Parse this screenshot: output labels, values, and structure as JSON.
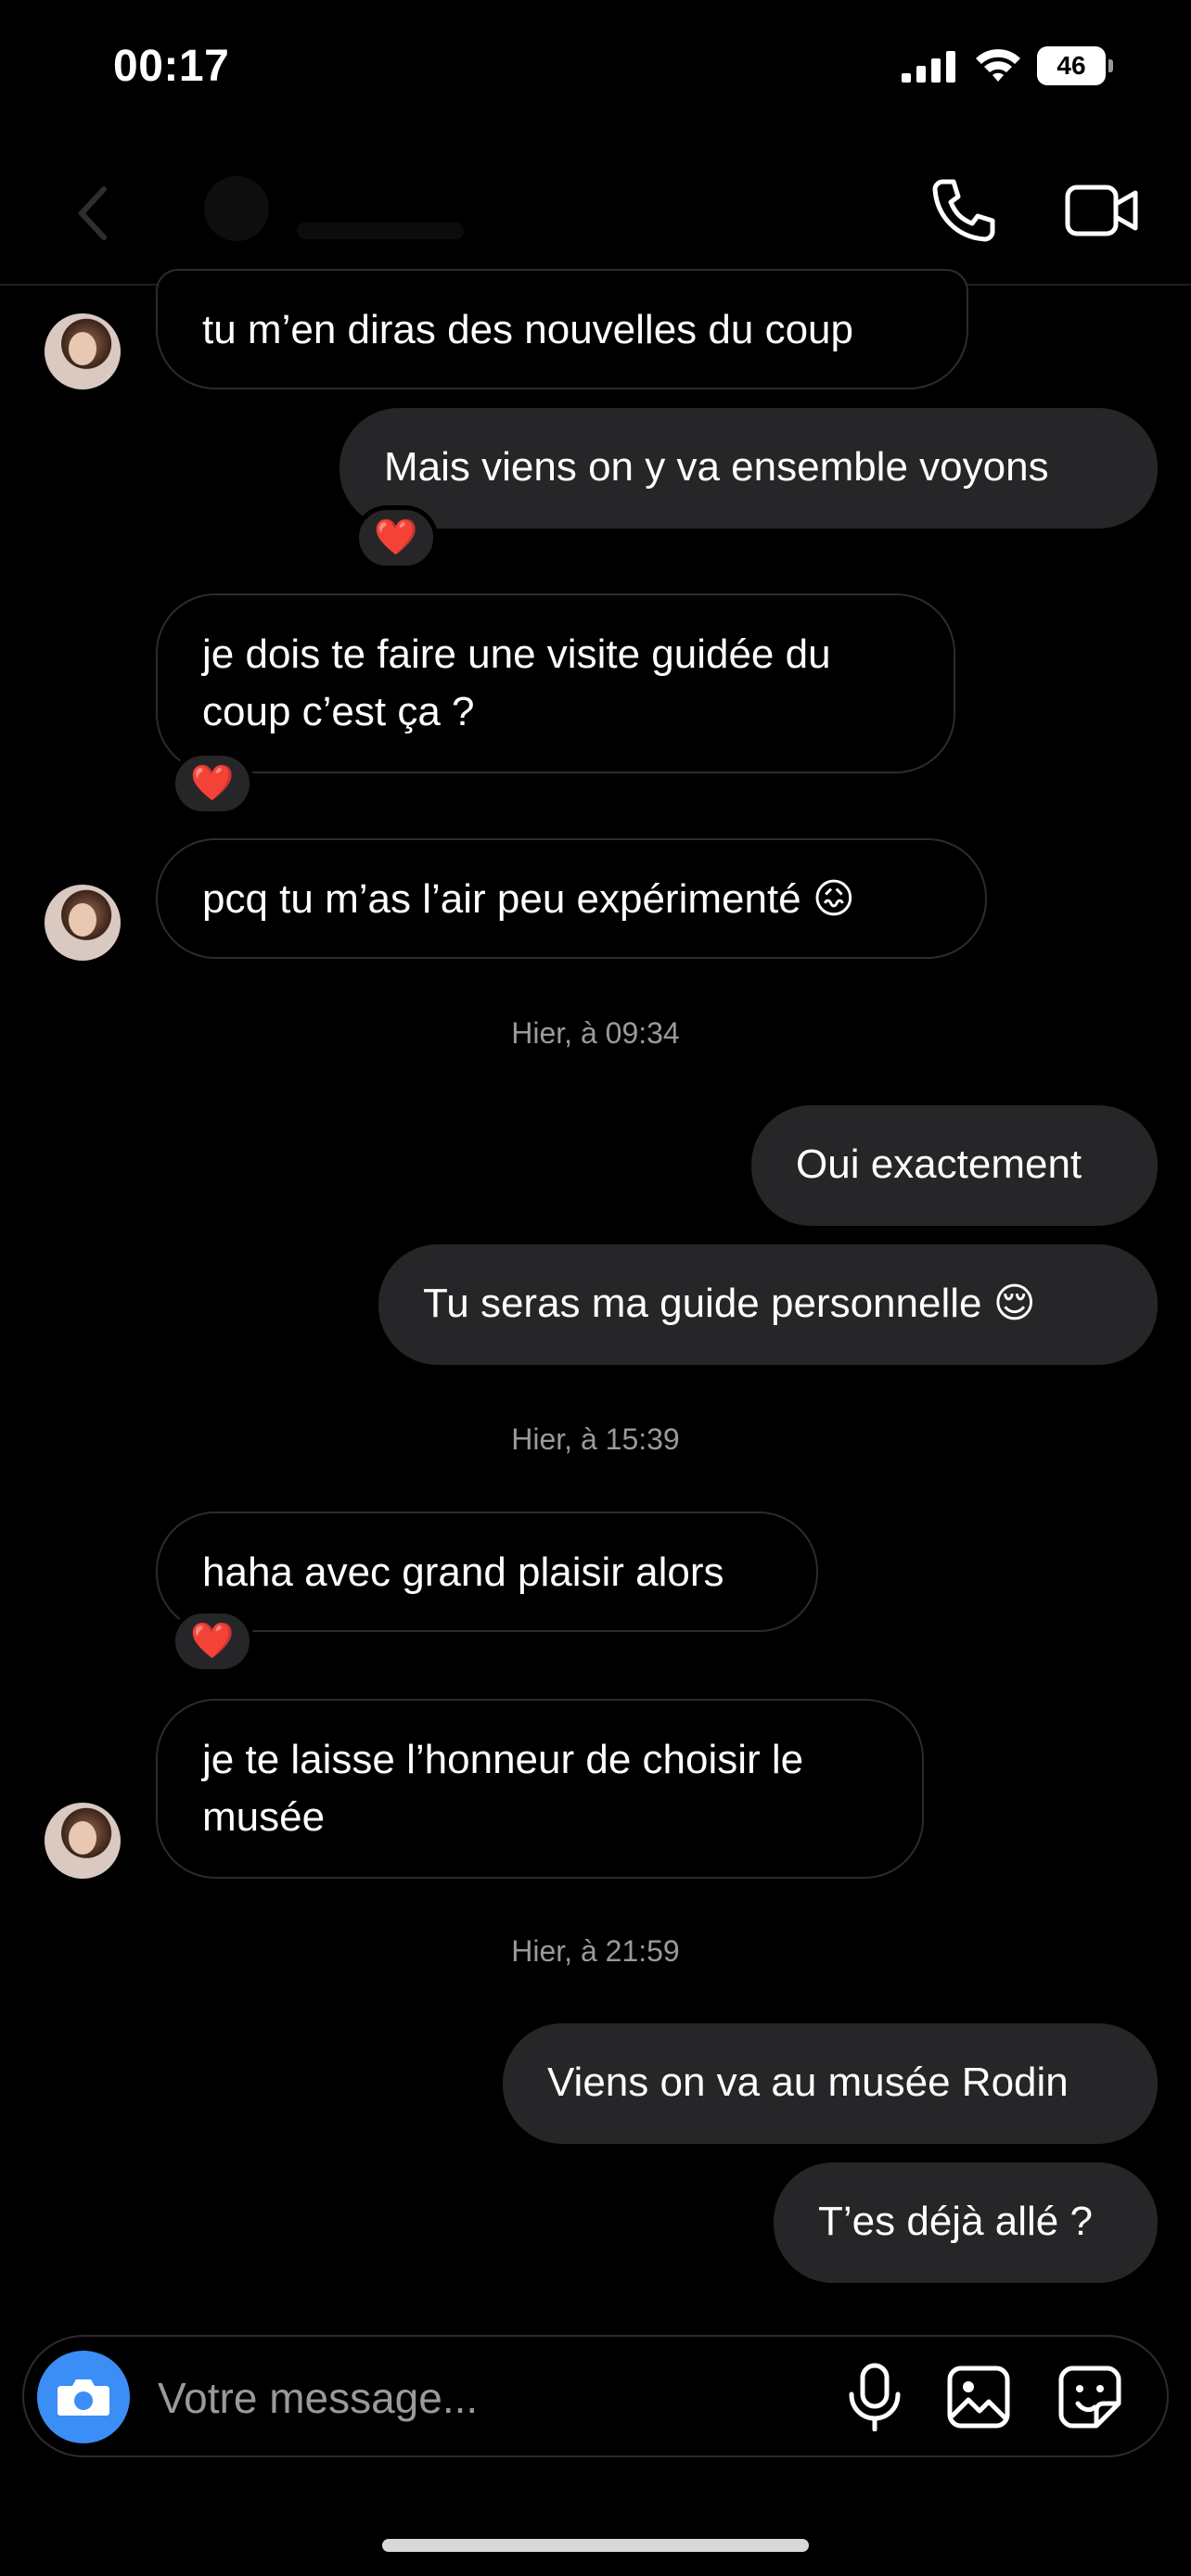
{
  "status_bar": {
    "time": "00:17",
    "battery": "46"
  },
  "header": {
    "call_icon": "phone-icon",
    "video_icon": "video-camera-icon"
  },
  "messages": [
    {
      "dir": "in",
      "text": "tu m’en diras des nouvelles du coup"
    },
    {
      "dir": "out",
      "text": "Mais viens on y va ensemble voyons",
      "reaction": "❤️"
    },
    {
      "dir": "in",
      "text": "je dois te faire une visite guidée du\ncoup c’est ça ?",
      "reaction": "❤️"
    },
    {
      "dir": "in",
      "text": "pcq tu m’as l’air peu expérimenté 😖"
    },
    {
      "dir": "out",
      "text": "Oui exactement"
    },
    {
      "dir": "out",
      "text": "Tu seras ma guide personnelle 😌"
    },
    {
      "dir": "in",
      "text": "haha avec grand plaisir alors",
      "reaction": "❤️"
    },
    {
      "dir": "in",
      "text": "je te laisse l’honneur de choisir le\nmusée"
    },
    {
      "dir": "out",
      "text": "Viens on va au musée Rodin"
    },
    {
      "dir": "out",
      "text": "T’es déjà allé ?"
    }
  ],
  "timestamps": [
    "Hier, à 09:34",
    "Hier, à 15:39",
    "Hier, à 21:59"
  ],
  "composer": {
    "placeholder": "Votre message...",
    "accent": "#3a8ef6"
  },
  "colors": {
    "background": "#000000",
    "outgoing_bubble": "#262628",
    "incoming_border": "#2c2c2e",
    "timestamp": "#9a9a9a"
  }
}
